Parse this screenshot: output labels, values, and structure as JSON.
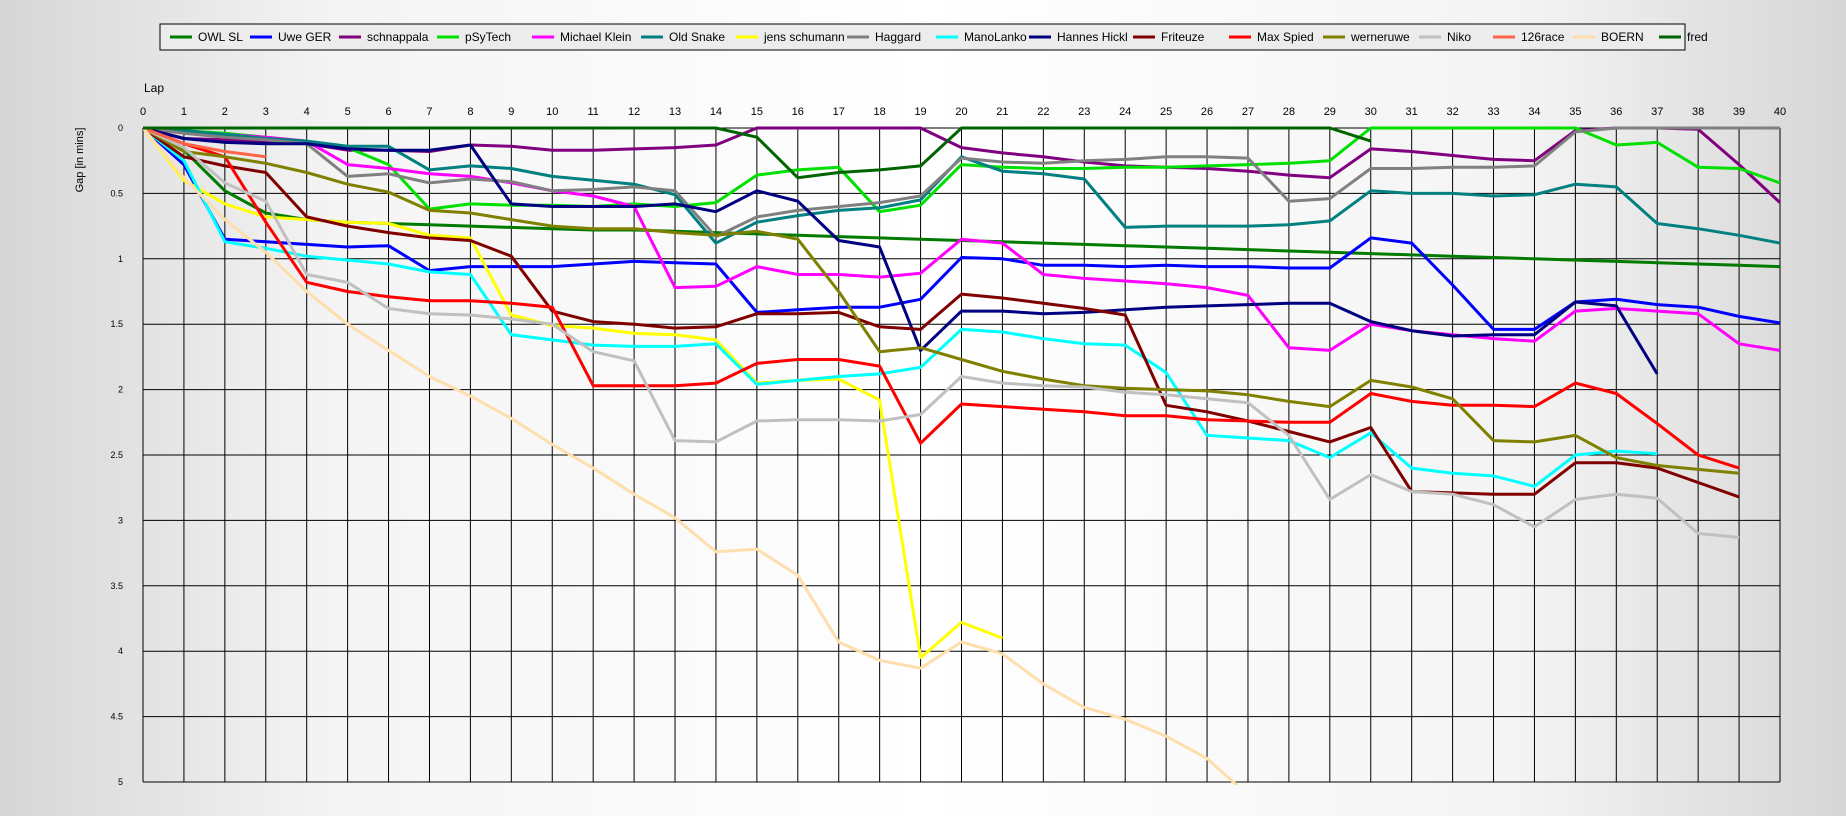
{
  "chart_data": {
    "type": "line",
    "xlabel": "Lap",
    "ylabel": "Gap [in mins]",
    "xlim": [
      0,
      40
    ],
    "ylim": [
      0,
      5
    ],
    "y_reversed": true,
    "grid": true,
    "legend_position": "top",
    "x_ticks": [
      "0",
      "1",
      "2",
      "3",
      "4",
      "5",
      "6",
      "7",
      "8",
      "9",
      "10",
      "11",
      "12",
      "13",
      "14",
      "15",
      "16",
      "17",
      "18",
      "19",
      "20",
      "21",
      "22",
      "23",
      "24",
      "25",
      "26",
      "27",
      "28",
      "29",
      "30",
      "31",
      "32",
      "33",
      "34",
      "35",
      "36",
      "37",
      "38",
      "39",
      "40"
    ],
    "y_ticks": [
      "0",
      "0.5",
      "1",
      "1.5",
      "2",
      "2.5",
      "3",
      "3.5",
      "4",
      "4.5",
      "5"
    ],
    "series": [
      {
        "name": "OWL SL",
        "color": "#007a00",
        "values": [
          0,
          0.17,
          0.48,
          0.65,
          0.7,
          0.72,
          0.73,
          0.74,
          0.75,
          0.76,
          0.77,
          0.78,
          0.78,
          0.79,
          0.8,
          0.81,
          0.82,
          0.83,
          0.84,
          0.85,
          0.86,
          0.87,
          0.88,
          0.89,
          0.9,
          0.91,
          0.92,
          0.93,
          0.94,
          0.95,
          0.96,
          0.97,
          0.98,
          0.99,
          1.0,
          1.01,
          1.02,
          1.03,
          1.04,
          1.05,
          1.06
        ]
      },
      {
        "name": "Uwe GER",
        "color": "#0000ff",
        "values": [
          0,
          0.28,
          0.85,
          0.87,
          0.89,
          0.91,
          0.9,
          1.09,
          1.06,
          1.06,
          1.06,
          1.04,
          1.02,
          1.03,
          1.04,
          1.41,
          1.39,
          1.37,
          1.37,
          1.31,
          0.99,
          1.0,
          1.05,
          1.05,
          1.06,
          1.05,
          1.06,
          1.06,
          1.07,
          1.07,
          0.84,
          0.88,
          1.2,
          1.54,
          1.54,
          1.33,
          1.31,
          1.35,
          1.37,
          1.44,
          1.49
        ]
      },
      {
        "name": "schnappala",
        "color": "#800080",
        "values": [
          0,
          0.08,
          0.09,
          0.1,
          0.12,
          0.17,
          0.17,
          0.18,
          0.13,
          0.14,
          0.17,
          0.17,
          0.16,
          0.15,
          0.13,
          0,
          0,
          0,
          0,
          0,
          0.15,
          0.19,
          0.22,
          0.26,
          0.29,
          0.3,
          0.31,
          0.33,
          0.36,
          0.38,
          0.16,
          0.18,
          0.21,
          0.24,
          0.25,
          0.02,
          0,
          0,
          0.01,
          0.28,
          0.57
        ]
      },
      {
        "name": "pSyTech",
        "color": "#00e000",
        "values": [
          0,
          0.02,
          0.04,
          0.07,
          0.1,
          0.15,
          0.28,
          0.62,
          0.58,
          0.59,
          0.59,
          0.6,
          0.58,
          0.6,
          0.57,
          0.36,
          0.32,
          0.3,
          0.64,
          0.59,
          0.28,
          0.3,
          0.31,
          0.31,
          0.3,
          0.3,
          0.29,
          0.28,
          0.27,
          0.25,
          0,
          0,
          0,
          0,
          0,
          0,
          0.13,
          0.11,
          0.3,
          0.31,
          0.42
        ]
      },
      {
        "name": "Michael Klein",
        "color": "#ff00ff",
        "values": [
          0,
          0.03,
          0.05,
          0.07,
          0.1,
          0.28,
          0.31,
          0.35,
          0.37,
          0.42,
          0.48,
          0.52,
          0.6,
          1.22,
          1.21,
          1.06,
          1.12,
          1.12,
          1.14,
          1.11,
          0.85,
          0.88,
          1.12,
          1.15,
          1.17,
          1.19,
          1.22,
          1.28,
          1.68,
          1.7,
          1.5,
          1.55,
          1.58,
          1.61,
          1.63,
          1.4,
          1.38,
          1.4,
          1.42,
          1.65,
          1.7
        ]
      },
      {
        "name": "Old Snake",
        "color": "#008080",
        "values": [
          0,
          0.02,
          0.05,
          0.08,
          0.1,
          0.14,
          0.14,
          0.32,
          0.29,
          0.31,
          0.37,
          0.4,
          0.43,
          0.51,
          0.88,
          0.72,
          0.67,
          0.63,
          0.61,
          0.55,
          0.22,
          0.33,
          0.35,
          0.39,
          0.76,
          0.75,
          0.75,
          0.75,
          0.74,
          0.71,
          0.48,
          0.5,
          0.5,
          0.52,
          0.51,
          0.43,
          0.45,
          0.73,
          0.77,
          0.82,
          0.88
        ]
      },
      {
        "name": "jens  schumann",
        "color": "#ffff00",
        "values": [
          0,
          0.4,
          0.58,
          0.68,
          0.7,
          0.72,
          0.73,
          0.82,
          0.84,
          1.43,
          1.51,
          1.53,
          1.57,
          1.58,
          1.62,
          1.95,
          1.93,
          1.92,
          2.08,
          4.05,
          3.78,
          3.9
        ]
      },
      {
        "name": "Haggard",
        "color": "#808080",
        "values": [
          0,
          0.04,
          0.07,
          0.09,
          0.12,
          0.37,
          0.35,
          0.42,
          0.39,
          0.41,
          0.48,
          0.47,
          0.45,
          0.48,
          0.83,
          0.68,
          0.63,
          0.6,
          0.57,
          0.52,
          0.23,
          0.26,
          0.27,
          0.25,
          0.24,
          0.22,
          0.22,
          0.23,
          0.56,
          0.54,
          0.31,
          0.31,
          0.3,
          0.3,
          0.29,
          0.03,
          0,
          0,
          0,
          0,
          0
        ]
      },
      {
        "name": "ManoLanko",
        "color": "#00ffff",
        "values": [
          0,
          0.25,
          0.87,
          0.92,
          0.98,
          1.01,
          1.04,
          1.1,
          1.12,
          1.58,
          1.62,
          1.66,
          1.67,
          1.67,
          1.65,
          1.96,
          1.93,
          1.9,
          1.88,
          1.83,
          1.54,
          1.56,
          1.61,
          1.65,
          1.66,
          1.87,
          2.35,
          2.37,
          2.39,
          2.52,
          2.33,
          2.6,
          2.64,
          2.66,
          2.74,
          2.5,
          2.47,
          2.49
        ]
      },
      {
        "name": "Hannes Hickl",
        "color": "#000080",
        "values": [
          0,
          0.08,
          0.11,
          0.12,
          0.12,
          0.16,
          0.17,
          0.17,
          0.13,
          0.58,
          0.6,
          0.6,
          0.6,
          0.58,
          0.64,
          0.48,
          0.56,
          0.86,
          0.91,
          1.7,
          1.4,
          1.4,
          1.42,
          1.41,
          1.39,
          1.37,
          1.36,
          1.35,
          1.34,
          1.34,
          1.48,
          1.55,
          1.59,
          1.58,
          1.58,
          1.33,
          1.36,
          1.88
        ]
      },
      {
        "name": "Friteuze",
        "color": "#800000",
        "values": [
          0,
          0.22,
          0.29,
          0.34,
          0.68,
          0.75,
          0.8,
          0.84,
          0.86,
          0.98,
          1.4,
          1.48,
          1.5,
          1.53,
          1.52,
          1.42,
          1.42,
          1.41,
          1.52,
          1.54,
          1.27,
          1.3,
          1.34,
          1.38,
          1.43,
          2.12,
          2.17,
          2.24,
          2.32,
          2.4,
          2.29,
          2.78,
          2.79,
          2.8,
          2.8,
          2.56,
          2.56,
          2.6,
          2.71,
          2.82
        ]
      },
      {
        "name": "Max Spied",
        "color": "#ff0000",
        "values": [
          0,
          0.12,
          0.22,
          0.72,
          1.18,
          1.25,
          1.29,
          1.32,
          1.32,
          1.34,
          1.37,
          1.97,
          1.97,
          1.97,
          1.95,
          1.8,
          1.77,
          1.77,
          1.82,
          2.41,
          2.11,
          2.13,
          2.15,
          2.17,
          2.2,
          2.2,
          2.23,
          2.24,
          2.25,
          2.25,
          2.03,
          2.09,
          2.12,
          2.12,
          2.13,
          1.95,
          2.03,
          2.26,
          2.5,
          2.6
        ]
      },
      {
        "name": "werneruwe",
        "color": "#808000",
        "values": [
          0,
          0.18,
          0.22,
          0.27,
          0.34,
          0.43,
          0.49,
          0.63,
          0.65,
          0.7,
          0.75,
          0.77,
          0.77,
          0.8,
          0.82,
          0.79,
          0.85,
          1.25,
          1.71,
          1.68,
          1.77,
          1.86,
          1.92,
          1.97,
          1.99,
          2.0,
          2.01,
          2.04,
          2.09,
          2.13,
          1.93,
          1.98,
          2.07,
          2.39,
          2.4,
          2.35,
          2.52,
          2.58,
          2.61,
          2.64
        ]
      },
      {
        "name": "Niko",
        "color": "#c0c0c0",
        "values": [
          0,
          0.15,
          0.42,
          0.56,
          1.12,
          1.18,
          1.38,
          1.42,
          1.43,
          1.46,
          1.5,
          1.71,
          1.78,
          2.39,
          2.4,
          2.24,
          2.23,
          2.23,
          2.24,
          2.19,
          1.9,
          1.95,
          1.97,
          1.98,
          2.02,
          2.04,
          2.07,
          2.1,
          2.35,
          2.84,
          2.65,
          2.78,
          2.8,
          2.88,
          3.05,
          2.84,
          2.8,
          2.83,
          3.1,
          3.13
        ]
      },
      {
        "name": "126race",
        "color": "#ff6347",
        "values": [
          0,
          0.12,
          0.18,
          0.22
        ]
      },
      {
        "name": "BOERN",
        "color": "#ffdead",
        "values": [
          0,
          0.38,
          0.7,
          0.95,
          1.25,
          1.5,
          1.7,
          1.9,
          2.05,
          2.22,
          2.42,
          2.6,
          2.8,
          2.98,
          3.24,
          3.22,
          3.42,
          3.93,
          4.07,
          4.13,
          3.93,
          4.02,
          4.25,
          4.43,
          4.52,
          4.65,
          4.82,
          5.1
        ]
      },
      {
        "name": "fred",
        "color": "#006400",
        "values": [
          0,
          0,
          0,
          0,
          0,
          0,
          0,
          0,
          0,
          0,
          0,
          0,
          0,
          0,
          0,
          0.07,
          0.38,
          0.34,
          0.32,
          0.29,
          0,
          0,
          0,
          0,
          0,
          0,
          0,
          0,
          0,
          0,
          0.1
        ]
      }
    ]
  }
}
